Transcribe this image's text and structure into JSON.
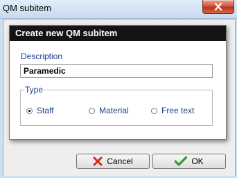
{
  "window": {
    "title": "QM subitem"
  },
  "dialog": {
    "header": "Create new QM subitem",
    "description_label": "Description",
    "description_value": "Paramedic",
    "type_label": "Type",
    "type_options": [
      {
        "label": "Staff",
        "selected": true
      },
      {
        "label": "Material",
        "selected": false
      },
      {
        "label": "Free text",
        "selected": false
      }
    ]
  },
  "buttons": {
    "cancel_label": "Cancel",
    "ok_label": "OK"
  },
  "icons": {
    "close": "close-icon",
    "cancel": "red-x-icon",
    "ok": "green-check-icon"
  }
}
